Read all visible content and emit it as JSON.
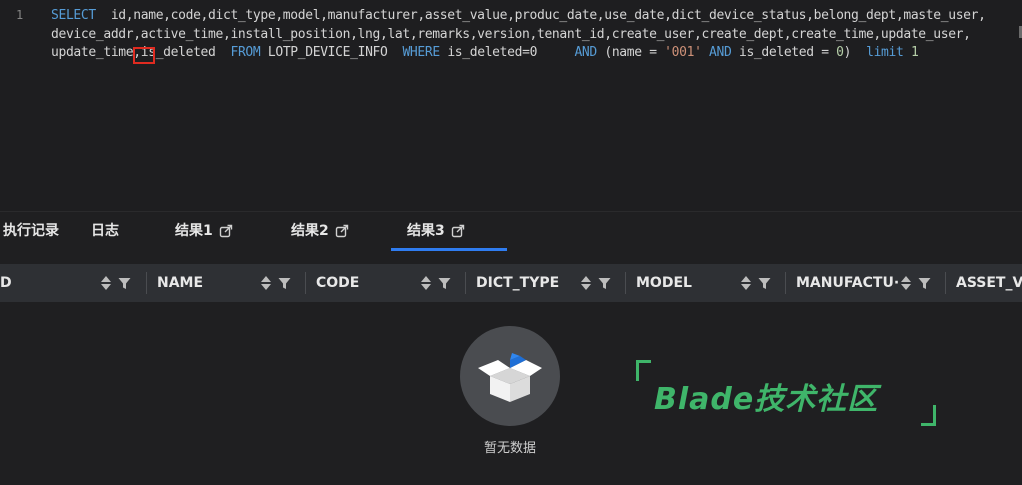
{
  "editor": {
    "line_number": "1",
    "sql": {
      "select_kw": "SELECT",
      "columns_line1": "  id,name,code,dict_type,model,manufacturer,asset_value,produc_date,use_date,dict_device_status,belong_dept,maste_user,",
      "columns_line2": "device_addr,active_time,install_position,lng,lat,remarks,version,tenant_id,create_user,create_dept,create_time,update_user,",
      "columns_line3a": "update_time",
      "columns_line3b": ",is",
      "columns_line3c": "_deleted  ",
      "from_kw": "FROM",
      "table": " LOTP_DEVICE_INFO  ",
      "where_kw": "WHERE",
      "where_cond": " is_deleted=0     ",
      "and_kw1": "AND",
      "paren_open": " (name = ",
      "name_value": "'001'",
      "and_kw2": "AND",
      "cond2": " is_deleted = ",
      "zero": "0",
      "paren_close": ")  ",
      "limit_kw": "limit",
      "limit_value": "1"
    }
  },
  "tabs": [
    {
      "label": "执行记录"
    },
    {
      "label": "日志"
    },
    {
      "label": "结果1"
    },
    {
      "label": "结果2"
    },
    {
      "label": "结果3"
    }
  ],
  "table": {
    "columns": [
      "D",
      "NAME",
      "CODE",
      "DICT_TYPE",
      "MODEL",
      "MANUFACTU···",
      "ASSET_VA"
    ]
  },
  "empty_state": {
    "text": "暂无数据"
  },
  "watermark": {
    "text": "Blade技术社区"
  },
  "colors": {
    "accent": "#2f7cf0",
    "watermark": "#3fb56a",
    "highlight": "#e02b20"
  }
}
